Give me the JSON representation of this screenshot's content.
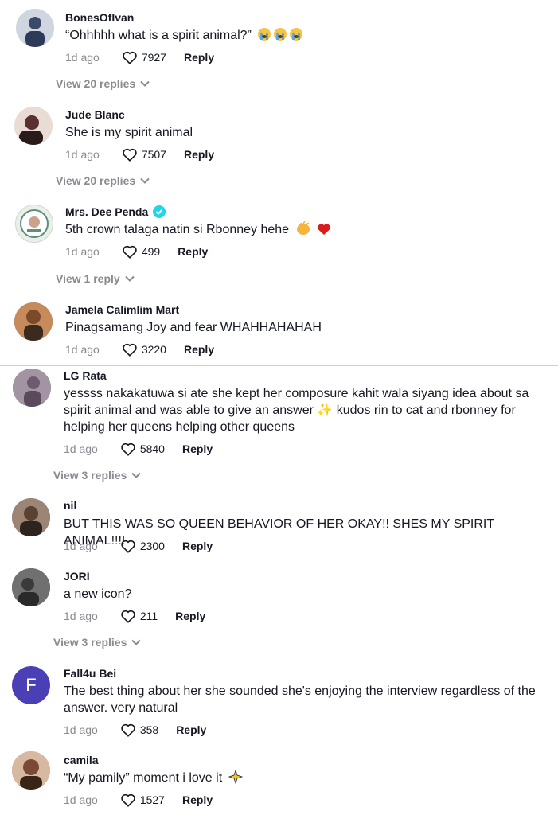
{
  "comments": [
    {
      "username": "BonesOfIvan",
      "text": "“Ohhhhh what is a spirit animal?”",
      "time": "1d ago",
      "likes": "7927",
      "reply": "Reply",
      "view_replies": "View 20 replies",
      "avatar_color": "#3b4a6b"
    },
    {
      "username": "Jude Blanc",
      "text": "She is my spirit animal",
      "time": "1d ago",
      "likes": "7507",
      "reply": "Reply",
      "view_replies": "View 20 replies",
      "avatar_color": "#6b3a3a"
    },
    {
      "username": "Mrs. Dee Penda",
      "text": "5th crown talaga natin si Rbonney hehe",
      "time": "1d ago",
      "likes": "499",
      "reply": "Reply",
      "view_replies": "View 1 reply",
      "avatar_color": "#e9efe9",
      "verified": true
    },
    {
      "username": "Jamela Calimlim Mart",
      "text": "Pinagsamang Joy and fear WHAHHAHAHAH",
      "time": "1d ago",
      "likes": "3220",
      "reply": "Reply",
      "avatar_color": "#a0622f"
    },
    {
      "username": "LG Rata",
      "text": "yessss nakakatuwa si ate she kept her composure kahit wala siyang idea about sa spirit animal and was able to give an answer ✨ kudos rin to cat and rbonney for helping her queens helping other queens",
      "time": "1d ago",
      "likes": "5840",
      "reply": "Reply",
      "view_replies": "View 3 replies",
      "avatar_color": "#8c7a8c"
    },
    {
      "username": "nil",
      "text": "BUT THIS WAS SO QUEEN BEHAVIOR OF HER OKAY!! SHES MY SPIRIT ANIMAL!!!!",
      "time": "1d ago",
      "likes": "2300",
      "reply": "Reply",
      "avatar_color": "#6d5848"
    },
    {
      "username": "JORI",
      "text": "a new icon?",
      "time": "1d ago",
      "likes": "211",
      "reply": "Reply",
      "view_replies": "View 3 replies",
      "avatar_color": "#555555"
    },
    {
      "username": "Fall4u Bei",
      "text": "The best thing about her she sounded she's enjoying the interview regardless of the answer. very natural",
      "time": "1d ago",
      "likes": "358",
      "reply": "Reply",
      "avatar_letter": "F",
      "avatar_color": "#4a3fb5"
    },
    {
      "username": "camila",
      "text": "“My pamily” moment i love it",
      "time": "1d ago",
      "likes": "1527",
      "reply": "Reply",
      "avatar_color": "#7a4a35"
    }
  ],
  "colors": {
    "text": "#161823",
    "muted": "#8a8b91",
    "verified": "#20d5ec",
    "heart": "#d81b1b"
  }
}
